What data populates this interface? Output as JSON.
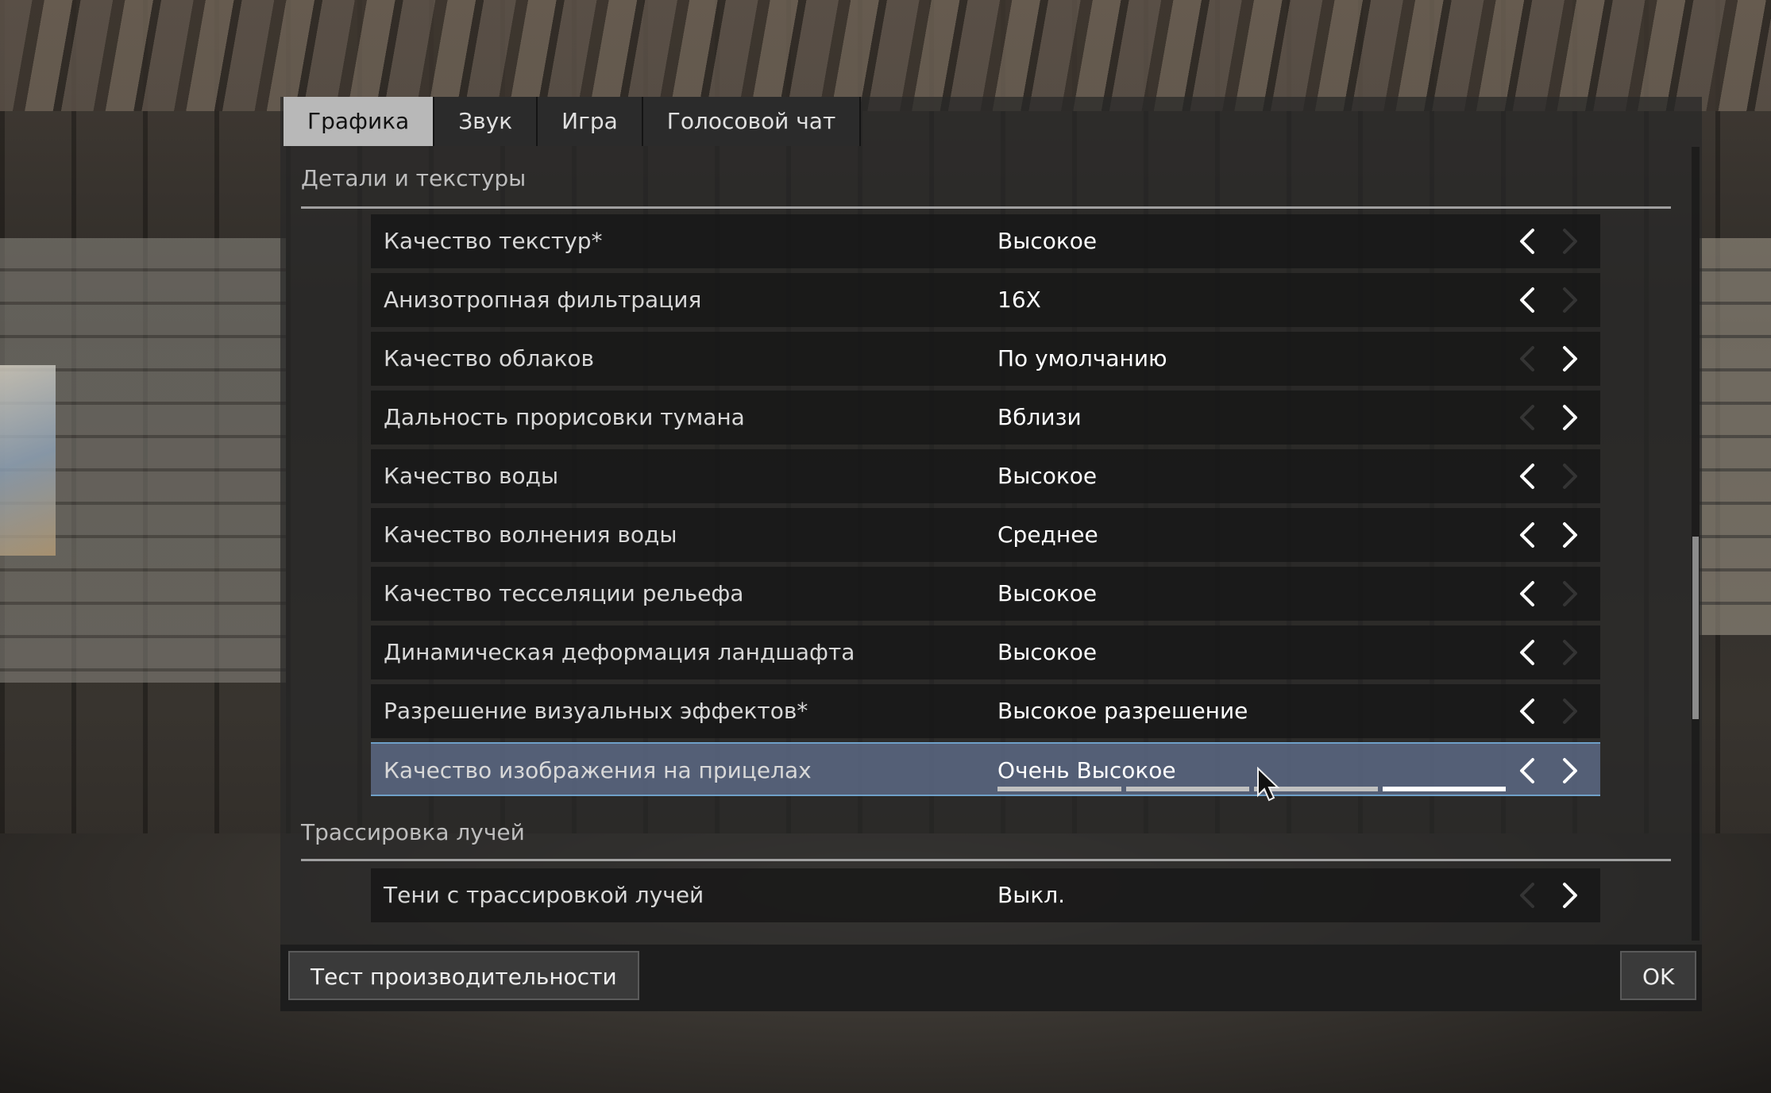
{
  "tabs": [
    {
      "label": "Графика",
      "active": true
    },
    {
      "label": "Звук",
      "active": false
    },
    {
      "label": "Игра",
      "active": false
    },
    {
      "label": "Голосовой чат",
      "active": false
    }
  ],
  "sections": {
    "details": {
      "title": "Детали и текстуры"
    },
    "raytracing": {
      "title": "Трассировка лучей"
    }
  },
  "settings": [
    {
      "label": "Качество текстур*",
      "value": "Высокое",
      "left_enabled": true,
      "right_enabled": false
    },
    {
      "label": "Анизотропная фильтрация",
      "value": "16X",
      "left_enabled": true,
      "right_enabled": false
    },
    {
      "label": "Качество облаков",
      "value": "По умолчанию",
      "left_enabled": false,
      "right_enabled": true
    },
    {
      "label": "Дальность прорисовки тумана",
      "value": "Вблизи",
      "left_enabled": false,
      "right_enabled": true
    },
    {
      "label": "Качество воды",
      "value": "Высокое",
      "left_enabled": true,
      "right_enabled": false
    },
    {
      "label": "Качество волнения воды",
      "value": "Среднее",
      "left_enabled": true,
      "right_enabled": true
    },
    {
      "label": "Качество тесселяции рельефа",
      "value": "Высокое",
      "left_enabled": true,
      "right_enabled": false
    },
    {
      "label": "Динамическая деформация ландшафта",
      "value": "Высокое",
      "left_enabled": true,
      "right_enabled": false
    },
    {
      "label": "Разрешение визуальных эффектов*",
      "value": "Высокое разрешение",
      "left_enabled": true,
      "right_enabled": false
    },
    {
      "label": "Качество изображения на прицелах",
      "value": "Очень Высокое",
      "left_enabled": true,
      "right_enabled": true,
      "selected": true,
      "level": {
        "current": 4,
        "total": 4
      }
    },
    {
      "label": "Тени с трассировкой лучей",
      "value": "Выкл.",
      "left_enabled": false,
      "right_enabled": true
    }
  ],
  "footer": {
    "benchmark_label": "Тест производительности",
    "ok_label": "OK"
  },
  "colors": {
    "selected_row": "#606e8c",
    "selected_border": "#6fa0c8",
    "active_tab": "#b8b8b8"
  },
  "icons": {
    "left": "chevron-left-icon",
    "right": "chevron-right-icon",
    "cursor": "mouse-cursor-icon"
  }
}
